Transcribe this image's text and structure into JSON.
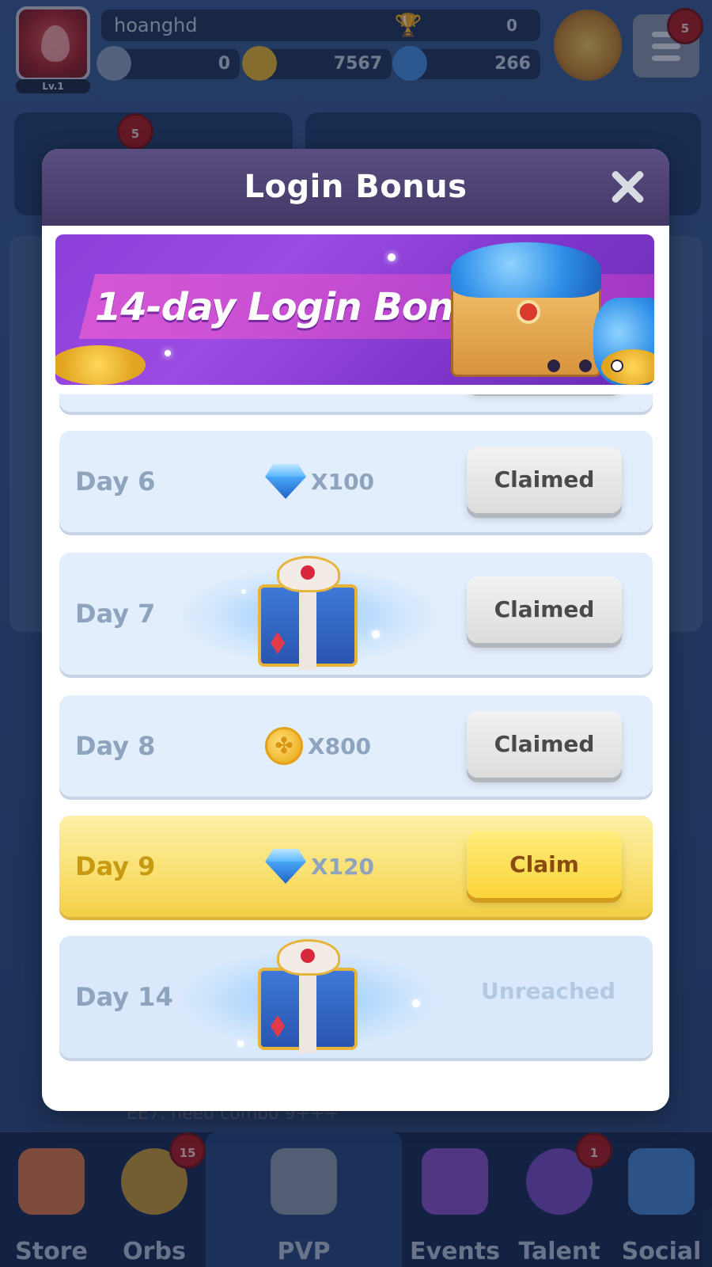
{
  "player": {
    "name": "hoanghd",
    "level": "Lv.1",
    "trophies": "0",
    "energy": "0",
    "coins": "7567",
    "gems": "266",
    "menu_badge": "5"
  },
  "background": {
    "mission_badge": "5",
    "chat_text": "EE7: need combo 9+++"
  },
  "modal": {
    "title": "Login Bonus",
    "banner_text": "14-day Login Bonus",
    "banner_page_count": 3,
    "banner_active_page": 3
  },
  "rows": [
    {
      "day": "Day 6",
      "reward_type": "gem-icon",
      "amount": "X100",
      "status": "Claimed"
    },
    {
      "day": "Day 7",
      "reward_type": "gift-box-icon",
      "amount": "",
      "status": "Claimed"
    },
    {
      "day": "Day 8",
      "reward_type": "coin-icon",
      "amount": "X800",
      "status": "Claimed"
    },
    {
      "day": "Day 9",
      "reward_type": "gem-icon",
      "amount": "X120",
      "status": "Claim"
    },
    {
      "day": "Day 14",
      "reward_type": "gift-box-icon",
      "amount": "",
      "status": "Unreached"
    }
  ],
  "nav": {
    "items": [
      {
        "label": "Store",
        "badge": "",
        "icon": "store-icon"
      },
      {
        "label": "Orbs",
        "badge": "15",
        "icon": "orbs-icon"
      },
      {
        "label": "PVP",
        "badge": "",
        "icon": "crossed-swords-icon"
      },
      {
        "label": "Events",
        "badge": "",
        "icon": "party-popper-icon"
      },
      {
        "label": "Talent",
        "badge": "1",
        "icon": "planet-icon"
      },
      {
        "label": "Social",
        "badge": "",
        "icon": "chat-heart-icon"
      }
    ]
  },
  "colors": {
    "modal_header": "#4a3e70",
    "row_default": "#e3eefc",
    "row_highlight": "#f9df6e",
    "claim_active": "#fbd43b",
    "claimed_button": "#e6e6e6"
  }
}
